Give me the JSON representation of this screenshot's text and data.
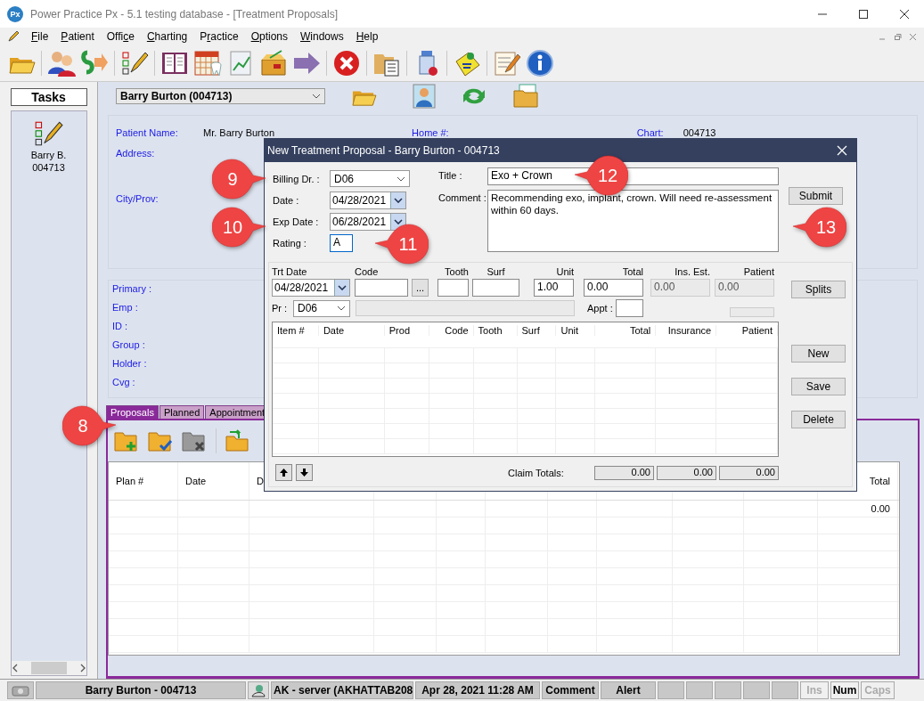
{
  "window": {
    "title": "Power Practice Px - 5.1 testing database - [Treatment Proposals]",
    "logo": "Px"
  },
  "menu": [
    {
      "key": "F",
      "after": "ile"
    },
    {
      "key": "P",
      "after": "atient"
    },
    {
      "before": "Offi",
      "key": "c",
      "after": "e"
    },
    {
      "key": "C",
      "after": "harting"
    },
    {
      "before": "P",
      "key": "r",
      "after": "actice"
    },
    {
      "key": "O",
      "after": "ptions"
    },
    {
      "key": "W",
      "after": "indows"
    },
    {
      "key": "H",
      "after": "elp"
    }
  ],
  "tasks": {
    "title": "Tasks",
    "patient_name": "Barry B.",
    "patient_id": "004713"
  },
  "patient_select": {
    "value": "Barry Burton (004713)"
  },
  "patient_info": {
    "fields": [
      {
        "label": "Patient Name:",
        "value": "Mr. Barry Burton"
      },
      {
        "label": "Address:"
      },
      {
        "label": "City/Prov:"
      }
    ],
    "home_label": "Home #:",
    "chart_label": "Chart:",
    "chart_value": "004713"
  },
  "insurance": [
    "Primary :",
    "Emp :",
    "ID :",
    "Group :",
    "Holder :",
    "Cvg :"
  ],
  "tabs": [
    {
      "label": "Proposals",
      "selected": true
    },
    {
      "label": "Planned",
      "selected": false
    },
    {
      "label": "Appointment",
      "selected": false
    }
  ],
  "plans_table": {
    "columns": [
      "Plan #",
      "Date",
      "D",
      "Total"
    ],
    "rows": [
      {
        "total": "0.00"
      }
    ]
  },
  "dialog": {
    "title": "New Treatment Proposal - Barry Burton - 004713",
    "billing_dr": {
      "label": "Billing Dr. :",
      "value": "D06"
    },
    "date": {
      "label": "Date :",
      "value": "04/28/2021"
    },
    "exp_date": {
      "label": "Exp Date :",
      "value": "06/28/2021"
    },
    "rating": {
      "label": "Rating :",
      "value": "A",
      "focused": true
    },
    "title_field": {
      "label": "Title :",
      "value": "Exo + Crown"
    },
    "comment": {
      "label": "Comment :",
      "value": "Recommending exo, implant, crown. Will need re-assessment within 60 days."
    },
    "submit": "Submit",
    "entry": {
      "trt_date": {
        "label": "Trt Date",
        "value": "04/28/2021"
      },
      "code": {
        "label": "Code"
      },
      "browse": "...",
      "tooth": {
        "label": "Tooth"
      },
      "surf": {
        "label": "Surf"
      },
      "unit": {
        "label": "Unit",
        "value": "1.00"
      },
      "total": {
        "label": "Total",
        "value": "0.00"
      },
      "ins_est": {
        "label": "Ins. Est.",
        "value": "0.00",
        "disabled": true
      },
      "patient": {
        "label": "Patient",
        "value": "0.00",
        "disabled": true
      },
      "pr": {
        "label": "Pr :",
        "value": "D06"
      },
      "appt": {
        "label": "Appt :"
      }
    },
    "splits": "Splits",
    "grid_columns": [
      "Item #",
      "Date",
      "Prod",
      "Code",
      "Tooth",
      "Surf",
      "Unit",
      "Total",
      "Insurance",
      "Patient"
    ],
    "buttons": [
      "New",
      "Save",
      "Delete"
    ],
    "claim_totals": {
      "label": "Claim Totals:",
      "values": [
        "0.00",
        "0.00",
        "0.00"
      ]
    }
  },
  "callouts": [
    {
      "number": "8",
      "kind": "right"
    },
    {
      "number": "9",
      "kind": "right"
    },
    {
      "number": "10",
      "kind": "right"
    },
    {
      "number": "11",
      "kind": "left"
    },
    {
      "number": "12",
      "kind": "left"
    },
    {
      "number": "13",
      "kind": "left"
    }
  ],
  "status_bar": {
    "patient": "Barry Burton - 004713",
    "user": "AK - server (AKHATTAB208",
    "datetime": "Apr 28, 2021 11:28 AM",
    "comment": "Comment",
    "alert": "Alert",
    "keys": [
      {
        "label": "Ins",
        "on": false
      },
      {
        "label": "Num",
        "on": true
      },
      {
        "label": "Caps",
        "on": false
      }
    ]
  }
}
